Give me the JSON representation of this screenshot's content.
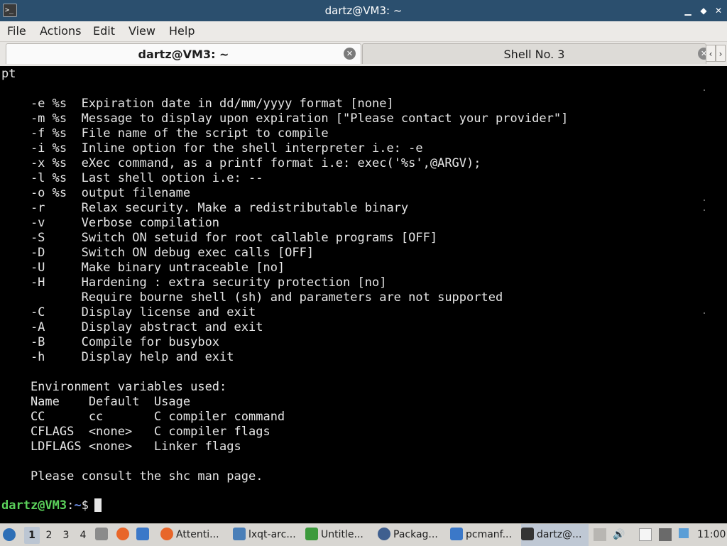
{
  "window": {
    "title": "dartz@VM3: ~",
    "app_icon_glyph": ">_",
    "minimize_glyph": "▁",
    "restore_glyph": "◆",
    "close_glyph": "✕"
  },
  "menu": [
    "File",
    "Actions",
    "Edit",
    "View",
    "Help"
  ],
  "tabs": [
    {
      "label": "dartz@VM3: ~",
      "active": true
    },
    {
      "label": "Shell No. 3",
      "active": false
    }
  ],
  "tab_close_glyph": "✕",
  "tab_scroll_left": "‹",
  "tab_scroll_right": "›",
  "terminal": {
    "lines": [
      "pt",
      "",
      "    -e %s  Expiration date in dd/mm/yyyy format [none]",
      "    -m %s  Message to display upon expiration [\"Please contact your provider\"]",
      "    -f %s  File name of the script to compile",
      "    -i %s  Inline option for the shell interpreter i.e: -e",
      "    -x %s  eXec command, as a printf format i.e: exec('%s',@ARGV);",
      "    -l %s  Last shell option i.e: --",
      "    -o %s  output filename",
      "    -r     Relax security. Make a redistributable binary",
      "    -v     Verbose compilation",
      "    -S     Switch ON setuid for root callable programs [OFF]",
      "    -D     Switch ON debug exec calls [OFF]",
      "    -U     Make binary untraceable [no]",
      "    -H     Hardening : extra security protection [no]",
      "           Require bourne shell (sh) and parameters are not supported",
      "    -C     Display license and exit",
      "    -A     Display abstract and exit",
      "    -B     Compile for busybox",
      "    -h     Display help and exit",
      "",
      "    Environment variables used:",
      "    Name    Default  Usage",
      "    CC      cc       C compiler command",
      "    CFLAGS  <none>   C compiler flags",
      "    LDFLAGS <none>   Linker flags",
      "",
      "    Please consult the shc man page."
    ],
    "prompt_user": "dartz@VM3",
    "prompt_sep": ":",
    "prompt_path": "~",
    "prompt_symbol": "$"
  },
  "taskbar": {
    "desktops": [
      "1",
      "2",
      "3",
      "4"
    ],
    "active_desktop": "1",
    "tasks": [
      {
        "label": "Attenti...",
        "icon": "firefox-icon",
        "color": "#e8662a"
      },
      {
        "label": "lxqt-arc...",
        "icon": "archive-icon",
        "color": "#4a7fb8"
      },
      {
        "label": "Untitle...",
        "icon": "spreadsheet-icon",
        "color": "#3c9a3c"
      },
      {
        "label": "Packag...",
        "icon": "package-icon",
        "color": "#3f5f8f"
      },
      {
        "label": "pcmanf...",
        "icon": "folder-icon",
        "color": "#3b78c8"
      },
      {
        "label": "dartz@...",
        "icon": "terminal-icon",
        "color": "#333333"
      }
    ],
    "clock": "11:00"
  }
}
